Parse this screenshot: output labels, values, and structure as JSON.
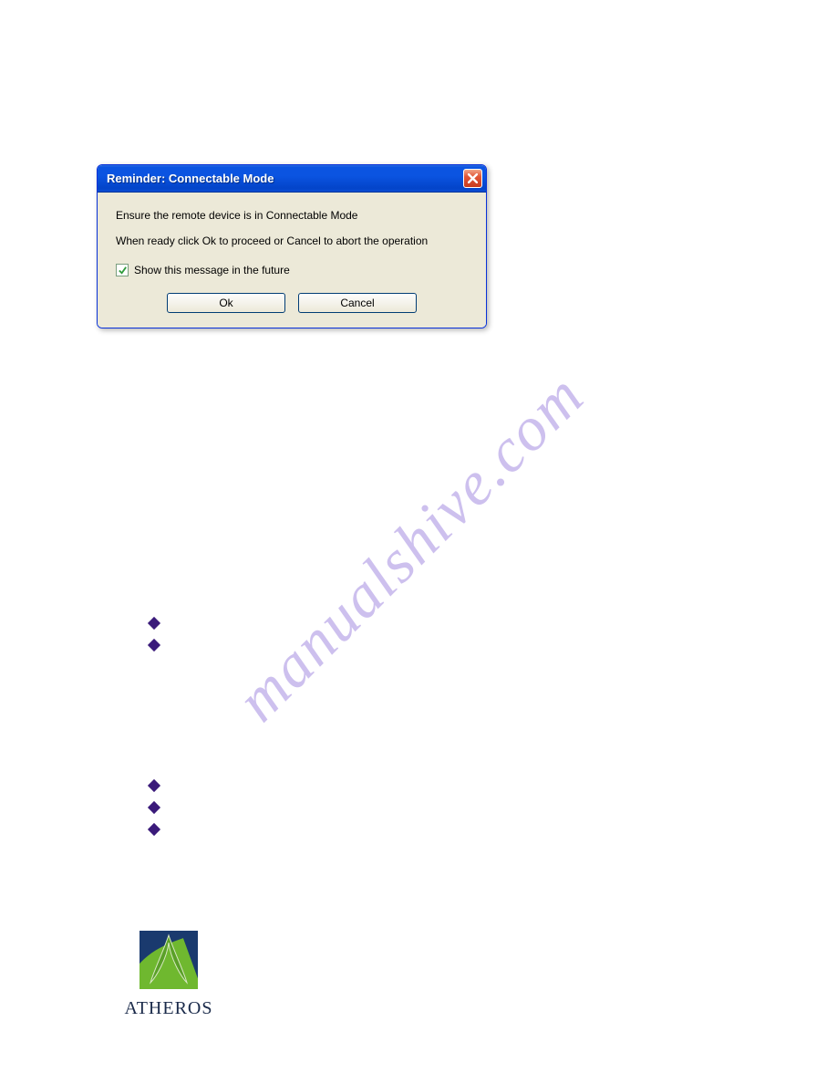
{
  "watermark": "manualshive.com",
  "dialog": {
    "title": "Reminder:  Connectable Mode",
    "line1_prefix": "Ensure the remote device is in   ",
    "line1_suffix": "Connectable Mode",
    "line2": "When ready click Ok to proceed or Cancel to abort the operation",
    "checkbox_checked": true,
    "checkbox_label": "Show this message in the future",
    "ok_label": "Ok",
    "cancel_label": "Cancel",
    "close_icon": "close-icon"
  },
  "logo": {
    "text": "ATHEROS",
    "mark_bg": "#1a3a6e",
    "mark_accent": "#6fb82f"
  },
  "colors": {
    "titlebar_blue": "#0b54e1",
    "body_beige": "#ece9d8",
    "bullet_purple": "#3a1a7a",
    "watermark_purple": "#b8a6e8"
  }
}
